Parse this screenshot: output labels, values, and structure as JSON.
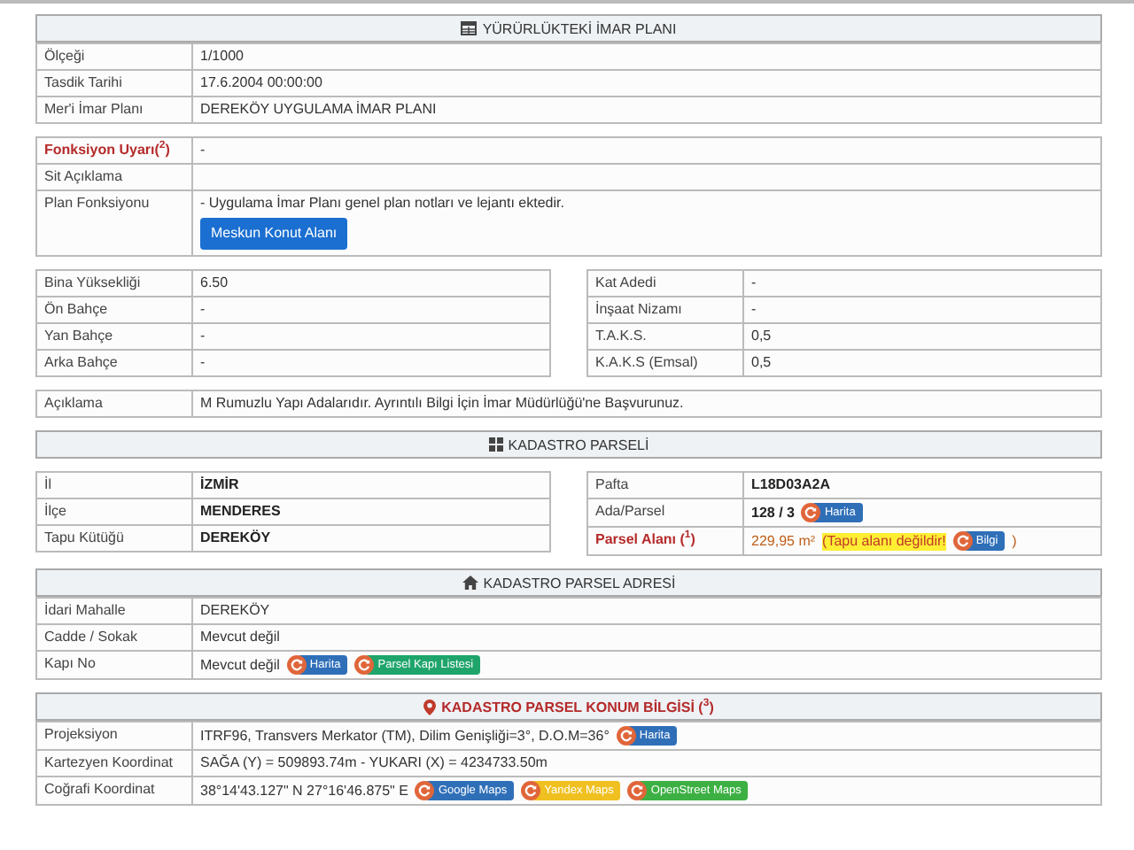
{
  "blocks": [
    {
      "kind": "table",
      "header": {
        "title": "YÜRÜRLÜKTEKİ İMAR PLANI",
        "kind": "plan"
      },
      "rows": [
        {
          "label": "Ölçeği",
          "kind": "plain",
          "value": "1/1000"
        },
        {
          "label": "Tasdik Tarihi",
          "kind": "plain",
          "value": "17.6.2004 00:00:00"
        },
        {
          "label": "Mer'i İmar Planı",
          "kind": "plain",
          "value": "DEREKÖY UYGULAMA İMAR PLANI"
        }
      ]
    },
    {
      "kind": "table",
      "rows": [
        {
          "label": "Fonksiyon Uyarı($^{2}$)",
          "kind": "warning",
          "value": "-"
        },
        {
          "label": "Sit Açıklama",
          "kind": "plain"
        },
        {
          "label": "Plan Fonksiyonu",
          "kind": "plain",
          "value": "- Uygulama İmar Planı genel plan notları ve lejantı ektedir.",
          "buttons": [
            {
              "label": "Meskun Konut Alanı",
              "kind": "block",
              "color": "#1a6fd1"
            }
          ]
        }
      ]
    },
    {
      "kind": "pair",
      "tables": [
        {
          "rows": [
            {
              "label": "Bina Yüksekliği",
              "kind": "plain",
              "value": "6.50"
            },
            {
              "label": "Ön Bahçe",
              "kind": "plain",
              "value": "-"
            },
            {
              "label": "Yan Bahçe",
              "kind": "plain",
              "value": "-"
            },
            {
              "label": "Arka Bahçe",
              "kind": "plain",
              "value": "-"
            }
          ]
        },
        {
          "rows": [
            {
              "label": "Kat Adedi",
              "kind": "plain",
              "value": "-"
            },
            {
              "label": "İnşaat Nizamı",
              "kind": "plain",
              "value": "-"
            },
            {
              "label": "T.A.K.S.",
              "kind": "plain",
              "value": "0,5"
            },
            {
              "label": "K.A.K.S (Emsal)",
              "kind": "plain",
              "value": "0,5"
            }
          ]
        }
      ]
    },
    {
      "kind": "table",
      "rows": [
        {
          "label": "Açıklama",
          "kind": "plain",
          "value": "M Rumuzlu Yapı Adalarıdır. Ayrıntılı Bilgi İçin İmar Müdürlüğü'ne Başvurunuz."
        }
      ]
    },
    {
      "kind": "table",
      "header": {
        "title": "KADASTRO PARSELİ",
        "kind": "parcel"
      }
    },
    {
      "kind": "pair",
      "tables": [
        {
          "rows": [
            {
              "label": "İl",
              "kind": "bold",
              "value": "İZMİR"
            },
            {
              "label": "İlçe",
              "kind": "bold",
              "value": "MENDERES"
            },
            {
              "label": "Tapu Kütüğü",
              "kind": "bold",
              "value": "DEREKÖY"
            }
          ]
        },
        {
          "rows": [
            {
              "label": "Pafta",
              "kind": "bold",
              "value": "L18D03A2A"
            },
            {
              "label": "Ada/Parsel",
              "kind": "bold",
              "value": "128 / 3",
              "buttons": [
                {
                  "label": "Harita",
                  "kind": "pill",
                  "color": "#2f6fb8"
                }
              ]
            },
            {
              "label": "Parsel Alanı ($^{1}$)",
              "kind": "area",
              "value": "229,95 m²",
              "note": "(Tapu alanı değildir!",
              "buttons": [
                {
                  "label": "Bilgi",
                  "kind": "pill",
                  "color": "#2f6fb8"
                }
              ],
              "suffix": ")"
            }
          ]
        }
      ]
    },
    {
      "kind": "table",
      "header": {
        "title": "KADASTRO PARSEL ADRESİ",
        "kind": "address"
      },
      "rows": [
        {
          "label": "İdari Mahalle",
          "kind": "plain",
          "value": "DEREKÖY"
        },
        {
          "label": "Cadde / Sokak",
          "kind": "plain",
          "value": "Mevcut değil"
        },
        {
          "label": "Kapı No",
          "kind": "plain",
          "value": "Mevcut değil",
          "buttons": [
            {
              "label": "Harita",
              "kind": "pill",
              "color": "#2f6fb8"
            },
            {
              "label": "Parsel Kapı Listesi",
              "kind": "pill",
              "color": "#1fa56b"
            }
          ]
        }
      ]
    },
    {
      "kind": "table",
      "header": {
        "title": "KADASTRO PARSEL KONUM BİLGİSİ ($^{3}$)",
        "kind": "location"
      },
      "rows": [
        {
          "label": "Projeksiyon",
          "kind": "plain",
          "value": "ITRF96, Transvers Merkator (TM), Dilim Genişliği=3°, D.O.M=36°",
          "buttons": [
            {
              "label": "Harita",
              "kind": "pill",
              "color": "#2f6fb8"
            }
          ]
        },
        {
          "label": "Kartezyen Koordinat",
          "kind": "plain",
          "value": "SAĞA (Y) = 509893.74m - YUKARI (X) = 4234733.50m"
        },
        {
          "label": "Coğrafi Koordinat",
          "kind": "plain",
          "value": "38°14'43.127\" N 27°16'46.875\" E",
          "buttons": [
            {
              "label": "Google Maps",
              "kind": "pill",
              "color": "#2f6fb8"
            },
            {
              "label": "Yandex Maps",
              "kind": "pill",
              "color": "#f0c020"
            },
            {
              "label": "OpenStreet Maps",
              "kind": "pill",
              "color": "#3cb043"
            }
          ]
        }
      ]
    }
  ]
}
